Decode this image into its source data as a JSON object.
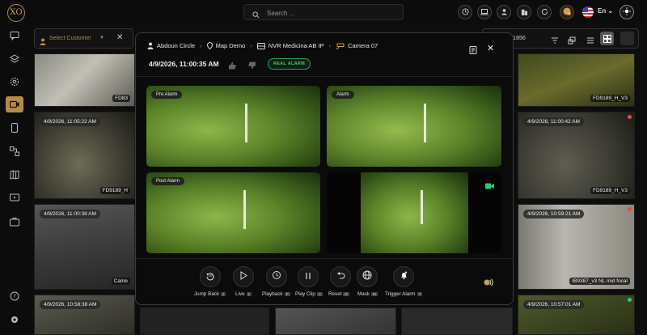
{
  "app": {
    "logo_text": "XO",
    "language": "En"
  },
  "search": {
    "placeholder": "Search ..."
  },
  "filters": {
    "customer_placeholder": "Select Customer",
    "events_count": "nts : 1856"
  },
  "tiles": [
    {
      "timestamp": "",
      "name": "FD83"
    },
    {
      "timestamp": "",
      "name": "FD9189_H_V3"
    },
    {
      "timestamp": "4/9/2026, 11:05:22 AM",
      "name": "FD9189_H"
    },
    {
      "timestamp": "4/9/2026, 11:00:42 AM",
      "name": "FD9189_H_V3"
    },
    {
      "timestamp": "4/9/2026, 11:00:38 AM",
      "name": "Came"
    },
    {
      "timestamp": "4/9/2026, 10:59:21 AM",
      "name": "IB9387_v3 NL mid focal"
    },
    {
      "timestamp": "4/9/2026, 10:58:38 AM",
      "name": ""
    },
    {
      "timestamp": "4/9/2026, 10:57:01 AM",
      "name": ""
    }
  ],
  "modal": {
    "breadcrumb": [
      "Abdoun Circle",
      "Map Demo",
      "NVR Medicina AB IP",
      "Camera 07"
    ],
    "datetime": "4/9/2026, 11:00:35 AM",
    "status_badge": "REAL ALARM",
    "panels": {
      "pre": "Pre Alarm",
      "alarm": "Alarm",
      "post": "Post Alarm"
    },
    "controls": [
      {
        "label": "Jump Back",
        "key": "J"
      },
      {
        "label": "Live",
        "key": "L"
      },
      {
        "label": "Playback",
        "key": "P"
      },
      {
        "label": "Play Clip",
        "key": "C"
      },
      {
        "label": "Reset",
        "key": "R"
      },
      {
        "label": "Mask",
        "key": "M"
      },
      {
        "label": "Trigger Alarm",
        "key": "T"
      }
    ],
    "jump_back_seconds": "10"
  },
  "colors": {
    "accent": "#b88a4a",
    "real_alarm": "#4cc56f",
    "live_dot": "#2ecc71",
    "alarm_dot": "#e74c3c"
  }
}
